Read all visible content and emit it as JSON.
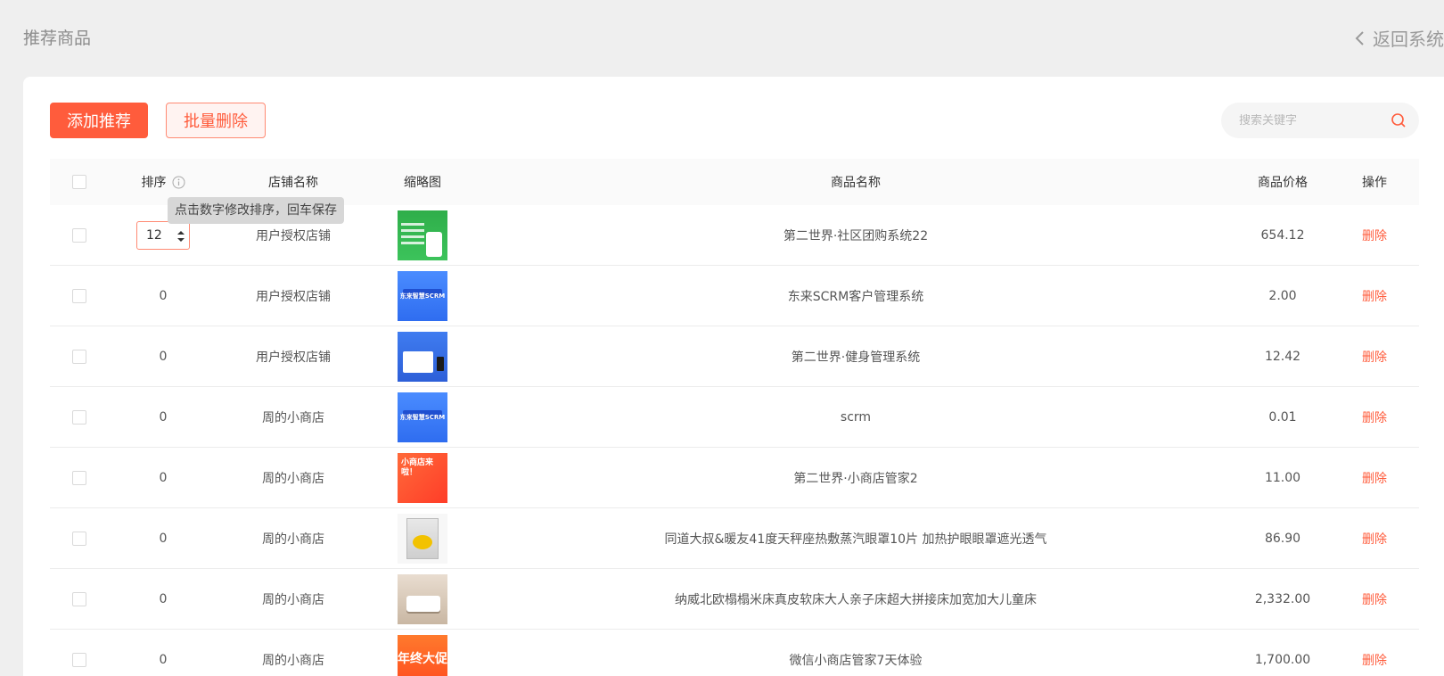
{
  "header": {
    "title": "推荐商品",
    "back_label": "返回系统"
  },
  "toolbar": {
    "add_label": "添加推荐",
    "batch_delete_label": "批量删除",
    "search_placeholder": "搜索关键字"
  },
  "table": {
    "columns": {
      "sort": "排序",
      "shop": "店铺名称",
      "thumb": "缩略图",
      "name": "商品名称",
      "price": "商品价格",
      "op": "操作"
    },
    "tooltip": "点击数字修改排序，回车保存",
    "delete_label": "删除",
    "rows": [
      {
        "sort": "12",
        "shop": "用户授权店铺",
        "thumb": "green-app",
        "thumb_text": "",
        "name": "第二世界·社区团购系统22",
        "price": "654.12"
      },
      {
        "sort": "0",
        "shop": "用户授权店铺",
        "thumb": "blue-scrm",
        "thumb_text": "东来智慧SCRM",
        "name": "东来SCRM客户管理系统",
        "price": "2.00"
      },
      {
        "sort": "0",
        "shop": "用户授权店铺",
        "thumb": "blue-fitness",
        "thumb_text": "",
        "name": "第二世界·健身管理系统",
        "price": "12.42"
      },
      {
        "sort": "0",
        "shop": "周的小商店",
        "thumb": "blue-scrm",
        "thumb_text": "东来智慧SCRM",
        "name": "scrm",
        "price": "0.01"
      },
      {
        "sort": "0",
        "shop": "周的小商店",
        "thumb": "orange-shop",
        "thumb_text": "小商店来啦！",
        "name": "第二世界·小商店管家2",
        "price": "11.00"
      },
      {
        "sort": "0",
        "shop": "周的小商店",
        "thumb": "eye-mask-box",
        "thumb_text": "",
        "name": "同道大叔&暖友41度天秤座热敷蒸汽眼罩10片 加热护眼眼罩遮光透气",
        "price": "86.90"
      },
      {
        "sort": "0",
        "shop": "周的小商店",
        "thumb": "bed-photo",
        "thumb_text": "",
        "name": "纳威北欧榻榻米床真皮软床大人亲子床超大拼接床加宽加大儿童床",
        "price": "2,332.00"
      },
      {
        "sort": "0",
        "shop": "周的小商店",
        "thumb": "promo",
        "thumb_text": "年终大促",
        "name": "微信小商店管家7天体验",
        "price": "1,700.00"
      }
    ]
  },
  "colors": {
    "accent": "#ff5c3c",
    "background": "#efefef",
    "panel": "#ffffff"
  }
}
